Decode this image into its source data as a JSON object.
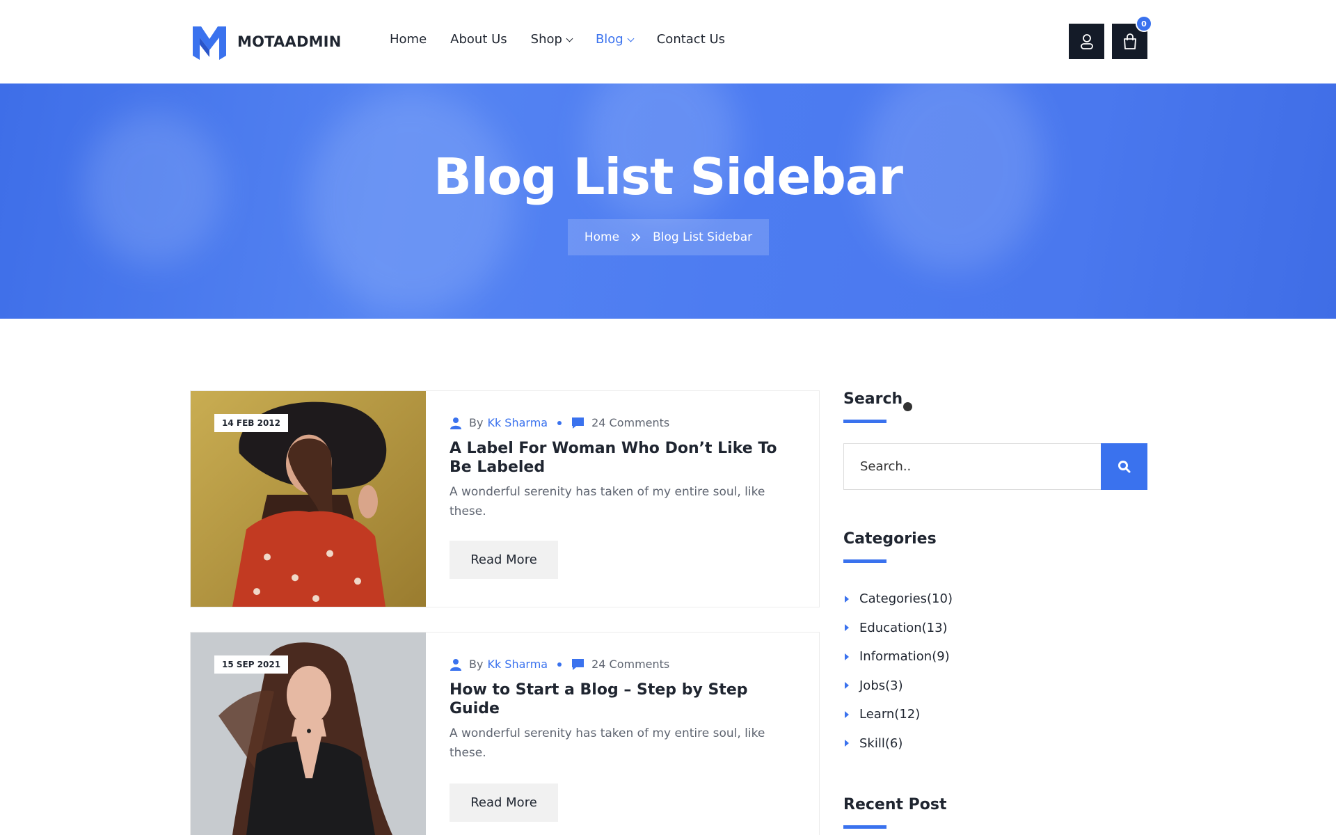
{
  "brand": {
    "name": "MOTAADMIN",
    "logo_icon": "m-logo-icon",
    "accent": "#3a72ee",
    "dark": "#141b28"
  },
  "nav": {
    "items": [
      {
        "label": "Home",
        "has_dropdown": false,
        "active": false
      },
      {
        "label": "About Us",
        "has_dropdown": false,
        "active": false
      },
      {
        "label": "Shop",
        "has_dropdown": true,
        "active": false
      },
      {
        "label": "Blog",
        "has_dropdown": true,
        "active": true
      },
      {
        "label": "Contact Us",
        "has_dropdown": false,
        "active": false
      }
    ]
  },
  "header_actions": {
    "user_icon": "user-icon",
    "cart_icon": "shopping-bag-icon",
    "cart_count": "0"
  },
  "banner": {
    "title": "Blog List Sidebar",
    "breadcrumb": {
      "home": "Home",
      "separator_icon": "double-chevron-right-icon",
      "current": "Blog List Sidebar"
    }
  },
  "posts": [
    {
      "date": "14 FEB 2012",
      "by": "By",
      "author": "Kk Sharma",
      "comments": "24 Comments",
      "title": "A Label For Woman Who Don’t Like To Be Labeled",
      "excerpt": "A wonderful serenity has taken of my entire soul, like these.",
      "read_more": "Read More"
    },
    {
      "date": "15 SEP 2021",
      "by": "By",
      "author": "Kk Sharma",
      "comments": "24 Comments",
      "title": "How to Start a Blog – Step by Step Guide",
      "excerpt": "A wonderful serenity has taken of my entire soul, like these.",
      "read_more": "Read More"
    }
  ],
  "sidebar": {
    "search": {
      "title": "Search",
      "placeholder": "Search..",
      "button_icon": "search-icon"
    },
    "categories": {
      "title": "Categories",
      "items": [
        {
          "label": "Categories(10)"
        },
        {
          "label": "Education(13)"
        },
        {
          "label": "Information(9)"
        },
        {
          "label": "Jobs(3)"
        },
        {
          "label": "Learn(12)"
        },
        {
          "label": "Skill(6)"
        }
      ]
    },
    "recent_post": {
      "title": "Recent Post"
    }
  }
}
